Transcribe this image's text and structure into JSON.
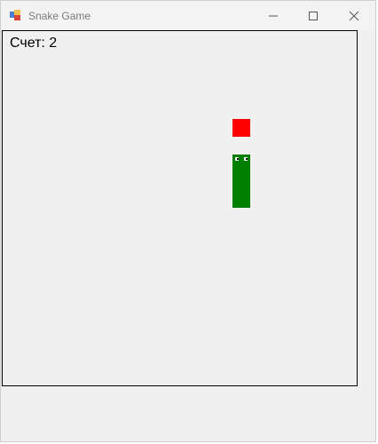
{
  "window": {
    "title": "Snake Game",
    "icon": "windows-forms-app-icon",
    "controls": [
      "minimize-icon",
      "maximize-icon",
      "close-icon"
    ]
  },
  "game": {
    "score_text": "Счет: 2",
    "score_value": 2,
    "colors": {
      "snake": "#008000",
      "food": "#ff0000",
      "field_background": "#f0f0f0",
      "field_border": "#000000"
    }
  }
}
